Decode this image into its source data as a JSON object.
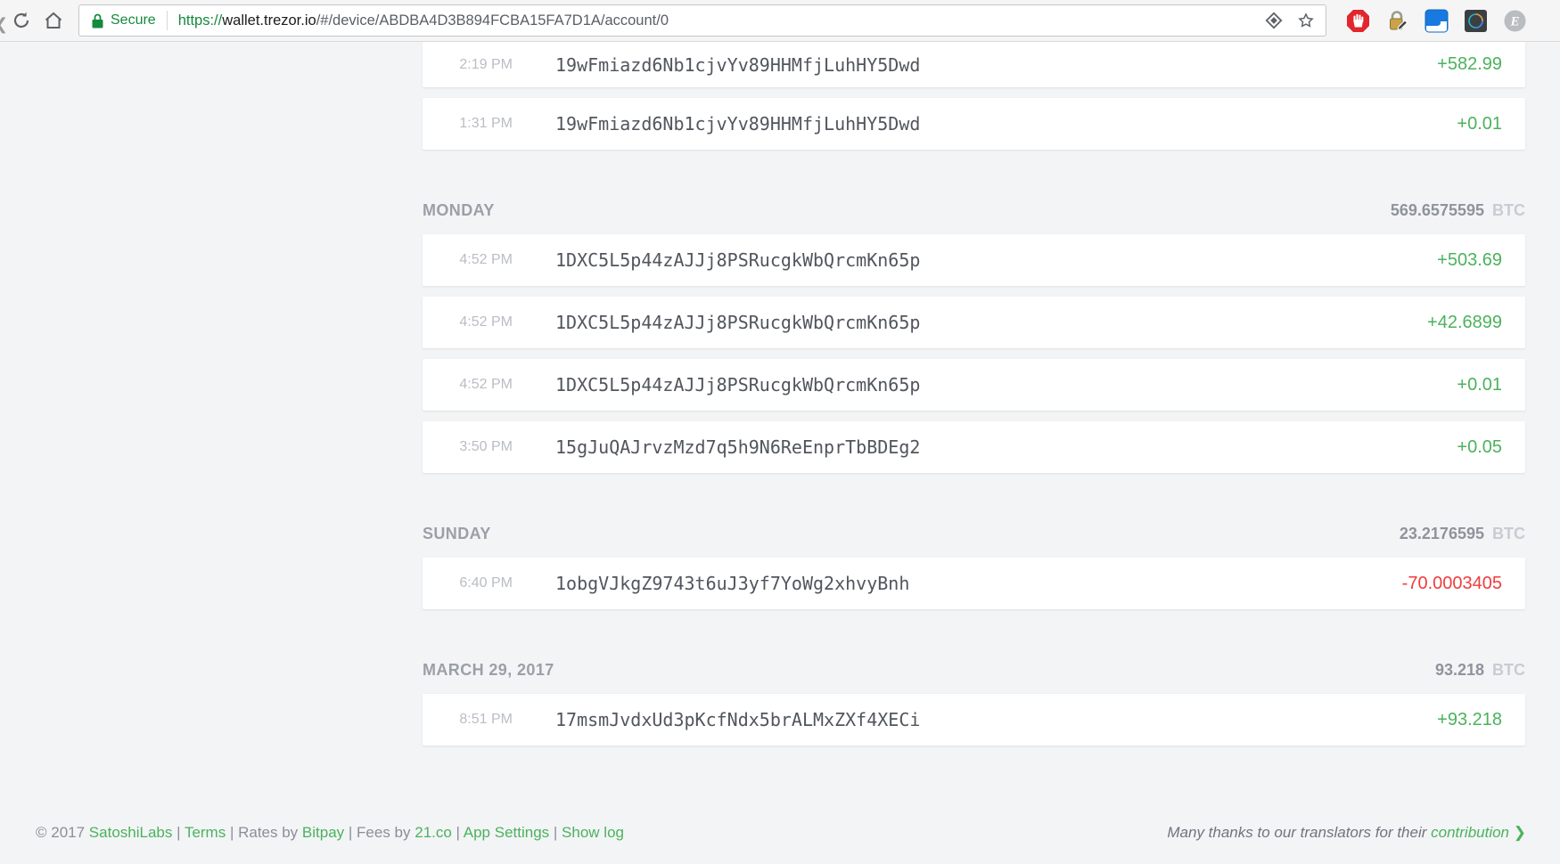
{
  "colors": {
    "green": "#4bb25c",
    "red": "#f03c3c",
    "secure_green": "#148a3d"
  },
  "browser": {
    "secure_label": "Secure",
    "url": {
      "scheme": "https://",
      "host": "wallet.trezor.io",
      "path": "/#/device/ABDBA4D3B894FCBA15FA7D1A/account/0"
    },
    "icons": [
      "back-icon",
      "reload-icon",
      "home-icon",
      "lock-icon",
      "page-action-diamond-icon",
      "bookmark-star-icon",
      "adblock-icon",
      "password-lock-icon",
      "blue-window-extension-icon",
      "dark-ring-extension-icon",
      "gray-e-extension-icon"
    ]
  },
  "transactions": {
    "groups": [
      {
        "label": null,
        "rows": [
          {
            "time": "2:19 PM",
            "address": "19wFmiazd6Nb1cjvYv89HHMfjLuhHY5Dwd",
            "amount": "+582.99",
            "clipped": true
          },
          {
            "time": "1:31 PM",
            "address": "19wFmiazd6Nb1cjvYv89HHMfjLuhHY5Dwd",
            "amount": "+0.01"
          }
        ]
      },
      {
        "label": "MONDAY",
        "total": "569.6575595",
        "currency": "BTC",
        "rows": [
          {
            "time": "4:52 PM",
            "address": "1DXC5L5p44zAJJj8PSRucgkWbQrcmKn65p",
            "amount": "+503.69"
          },
          {
            "time": "4:52 PM",
            "address": "1DXC5L5p44zAJJj8PSRucgkWbQrcmKn65p",
            "amount": "+42.6899"
          },
          {
            "time": "4:52 PM",
            "address": "1DXC5L5p44zAJJj8PSRucgkWbQrcmKn65p",
            "amount": "+0.01"
          },
          {
            "time": "3:50 PM",
            "address": "15gJuQAJrvzMzd7q5h9N6ReEnprTbBDEg2",
            "amount": "+0.05"
          }
        ]
      },
      {
        "label": "SUNDAY",
        "total": "23.2176595",
        "currency": "BTC",
        "rows": [
          {
            "time": "6:40 PM",
            "address": "1obgVJkgZ9743t6uJ3yf7YoWg2xhvyBnh",
            "amount": "-70.0003405"
          }
        ]
      },
      {
        "label": "MARCH 29, 2017",
        "total": "93.218",
        "currency": "BTC",
        "rows": [
          {
            "time": "8:51 PM",
            "address": "17msmJvdxUd3pKcfNdx5brALMxZXf4XECi",
            "amount": "+93.218"
          }
        ]
      }
    ]
  },
  "footer": {
    "left_segments": [
      {
        "text": "© 2017 ",
        "link": false
      },
      {
        "text": "SatoshiLabs",
        "link": true
      },
      {
        "text": " | ",
        "link": false
      },
      {
        "text": "Terms",
        "link": true
      },
      {
        "text": " | ",
        "link": false
      },
      {
        "text": "Rates by ",
        "link": false
      },
      {
        "text": "Bitpay",
        "link": true
      },
      {
        "text": " | ",
        "link": false
      },
      {
        "text": "Fees by ",
        "link": false
      },
      {
        "text": "21.co",
        "link": true
      },
      {
        "text": " | ",
        "link": false
      },
      {
        "text": "App Settings",
        "link": true
      },
      {
        "text": " | ",
        "link": false
      },
      {
        "text": "Show log",
        "link": true
      }
    ],
    "right": {
      "text": "Many thanks to our translators for their ",
      "link_label": "contribution",
      "arrow": "❯"
    }
  }
}
